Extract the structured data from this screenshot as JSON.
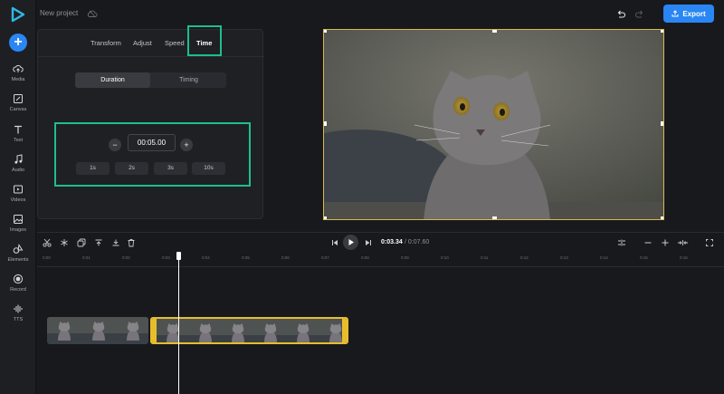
{
  "header": {
    "project_title": "New project",
    "export_label": "Export"
  },
  "sidebar": {
    "items": [
      {
        "label": "Media",
        "icon": "cloud-upload-icon"
      },
      {
        "label": "Canvas",
        "icon": "canvas-icon"
      },
      {
        "label": "Text",
        "icon": "text-icon"
      },
      {
        "label": "Audio",
        "icon": "music-note-icon"
      },
      {
        "label": "Videos",
        "icon": "video-icon"
      },
      {
        "label": "Images",
        "icon": "image-icon"
      },
      {
        "label": "Elements",
        "icon": "shapes-icon"
      },
      {
        "label": "Record",
        "icon": "record-icon"
      },
      {
        "label": "TTS",
        "icon": "waveform-icon"
      }
    ]
  },
  "panel": {
    "tabs": [
      "Transform",
      "Adjust",
      "Speed",
      "Time"
    ],
    "active_tab": "Time",
    "segment": [
      "Duration",
      "Timing"
    ],
    "active_segment": "Duration",
    "duration_value": "00:05.00",
    "decrement_label": "−",
    "increment_label": "+",
    "presets": [
      "1s",
      "2s",
      "3s",
      "10s"
    ]
  },
  "timeline": {
    "current_time": "0:03.34",
    "total_time": "/ 0:07.60",
    "ticks": [
      "0:00",
      "0:01",
      "0:02",
      "0:03",
      "0:04",
      "0:05",
      "0:06",
      "0:07",
      "0:08",
      "0:09",
      "0:10",
      "0:11",
      "0:12",
      "0:13",
      "0:14",
      "0:15",
      "0:16"
    ]
  },
  "colors": {
    "accent": "#2a86f3",
    "highlight": "#1dbf88",
    "selection": "#e8bd2b"
  }
}
